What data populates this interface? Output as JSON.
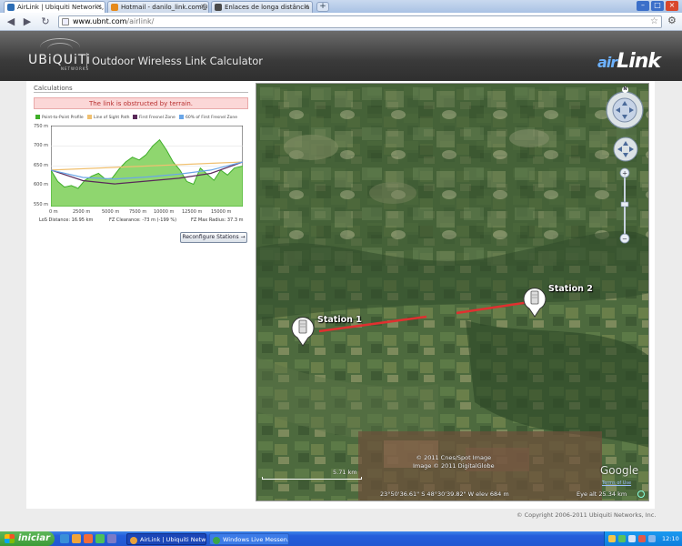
{
  "browser": {
    "tabs": [
      {
        "title": "AirLink | Ubiquiti Networks, ...",
        "favicon_color": "#2c6db5"
      },
      {
        "title": "Hotmail - danilo_link.com@...",
        "favicon_color": "#e68a1c"
      },
      {
        "title": "Enlaces de longa distância ...",
        "favicon_color": "#4a4a4a"
      }
    ],
    "new_tab": "+",
    "window_controls": [
      "–",
      "□",
      "×"
    ],
    "url_host": "www.ubnt.com",
    "url_path": "/airlink/",
    "nav": {
      "back": "◀",
      "forward": "▶",
      "reload": "↻"
    },
    "star_icon": "☆",
    "wrench_icon": "🔧"
  },
  "header": {
    "logo_text": "UBiQUiTi",
    "logo_sub": "NETWORKS",
    "title": "Outdoor Wireless Link Calculator",
    "brand_prefix": "air",
    "brand_main": "Link"
  },
  "calculations": {
    "heading": "Calculations",
    "obstruction_message": "The link is obstructed by terrain.",
    "legend": [
      {
        "label": "Point-to-Point Profile",
        "color": "#3fae29"
      },
      {
        "label": "Line of Sight Path",
        "color": "#f0c070"
      },
      {
        "label": "First Fresnel Zone",
        "color": "#5a2a5a"
      },
      {
        "label": "60% of First Fresnel Zone",
        "color": "#6aa6e8"
      }
    ],
    "los_distance_label": "LoS Distance:",
    "los_distance_value": "16.95 km",
    "fz_clearance_label": "FZ Clearance:",
    "fz_clearance_value": "-73 m  (-199 %)",
    "fz_max_radius_label": "FZ Max Radius:",
    "fz_max_radius_value": "37.3 m",
    "reconfigure_label": "Reconfigure Stations →"
  },
  "chart_data": {
    "type": "area",
    "title": "",
    "xlabel": "",
    "ylabel": "",
    "y_ticks": [
      "750 m",
      "700 m",
      "650 m",
      "600 m",
      "550 m"
    ],
    "x_ticks": [
      "0 m",
      "2500 m",
      "5000 m",
      "7500 m",
      "10000 m",
      "12500 m",
      "15000 m"
    ],
    "xlim": [
      0,
      16950
    ],
    "ylim": [
      550,
      750
    ],
    "series": [
      {
        "name": "Point-to-Point Profile",
        "x": [
          0,
          600,
          1200,
          1800,
          2400,
          3000,
          3600,
          4200,
          4800,
          5400,
          6000,
          6600,
          7200,
          7800,
          8400,
          9000,
          9600,
          10200,
          10800,
          11400,
          12000,
          12600,
          13200,
          13800,
          14400,
          15000,
          15600,
          16200,
          16950
        ],
        "y": [
          640,
          612,
          598,
          602,
          595,
          615,
          625,
          632,
          618,
          620,
          642,
          660,
          672,
          665,
          678,
          700,
          715,
          690,
          660,
          640,
          612,
          605,
          645,
          630,
          615,
          640,
          628,
          645,
          650
        ]
      },
      {
        "name": "Line of Sight Path",
        "x": [
          0,
          16950
        ],
        "y": [
          640,
          660
        ]
      },
      {
        "name": "First Fresnel Zone",
        "x": [
          0,
          2825,
          5650,
          8475,
          11300,
          14125,
          16950
        ],
        "y": [
          640,
          614,
          606,
          613,
          620,
          632,
          660
        ]
      },
      {
        "name": "60% of First Fresnel Zone",
        "x": [
          0,
          2825,
          5650,
          8475,
          11300,
          14125,
          16950
        ],
        "y": [
          640,
          622,
          618,
          623,
          630,
          640,
          660
        ]
      }
    ]
  },
  "map": {
    "station1_label": "Station 1",
    "station2_label": "Station 2",
    "scale_label": "5.71 km",
    "imagery_credit_line1": "© 2011 Cnes/Spot Image",
    "imagery_credit_line2": "Image © 2011 DigitalGlobe",
    "coords": "23°50'36.61\" S    48°30'39.82\" W  elev  684 m",
    "eye_alt": "Eye alt    25.34 km",
    "google_logo": "Google",
    "terms_link": "Terms of Use",
    "compass_north": "N"
  },
  "footer": {
    "copyright": "© Copyright 2006-2011 Ubiquiti Networks, Inc."
  },
  "taskbar": {
    "start_label": "iniciar",
    "tasks": [
      {
        "label": "AirLink | Ubiquiti Netw...",
        "icon_color": "#e9a23b"
      },
      {
        "label": "Windows Live Messen...",
        "icon_color": "#3aa64a"
      }
    ],
    "clock": "12:10"
  }
}
